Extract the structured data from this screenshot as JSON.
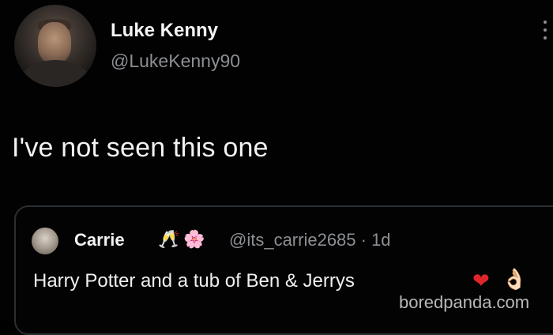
{
  "author": {
    "display_name": "Luke Kenny",
    "handle": "@LukeKenny90"
  },
  "tweet": {
    "text": "I've not seen this one"
  },
  "quoted_tweet": {
    "display_name": "Carrie",
    "emoji_1": "🥂",
    "emoji_2": "🌸",
    "handle_time": "@its_carrie2685 · 1d",
    "text": "Harry Potter and a tub of Ben & Jerrys",
    "emoji_heart": "❤",
    "emoji_ok": "👌🏻"
  },
  "watermark": "boredpanda.com",
  "colors": {
    "background": "#000000",
    "secondary_text": "#8c8f93",
    "heart": "#e0262a",
    "card_border": "#2b2f33"
  },
  "icons": [
    "more-options-icon"
  ]
}
